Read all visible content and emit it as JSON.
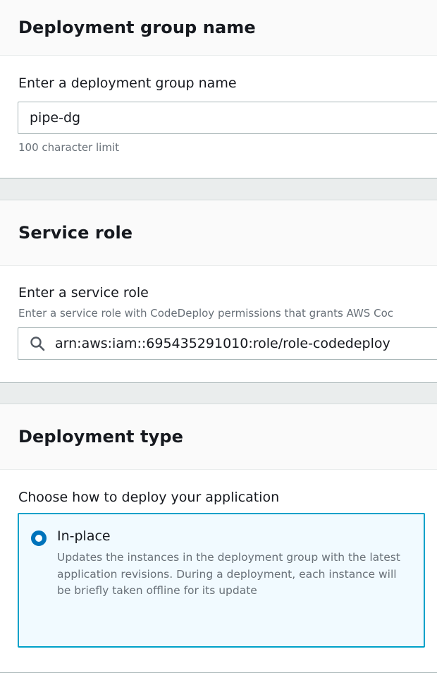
{
  "deployment_group": {
    "title": "Deployment group name",
    "label": "Enter a deployment group name",
    "value": "pipe-dg",
    "hint": "100 character limit"
  },
  "service_role": {
    "title": "Service role",
    "label": "Enter a service role",
    "description": "Enter a service role with CodeDeploy permissions that grants AWS Coc",
    "value": "arn:aws:iam::695435291010:role/role-codedeploy",
    "icon": "search-icon"
  },
  "deployment_type": {
    "title": "Deployment type",
    "label": "Choose how to deploy your application",
    "options": [
      {
        "label": "In-place",
        "description": "Updates the instances in the deployment group with the latest application revisions. During a deployment, each instance will be briefly taken offline for its update",
        "selected": true
      }
    ]
  },
  "colors": {
    "accent": "#0073bb",
    "selected_border": "#00a1c9",
    "selected_background": "#f1faff",
    "page_background": "#eaeded"
  }
}
